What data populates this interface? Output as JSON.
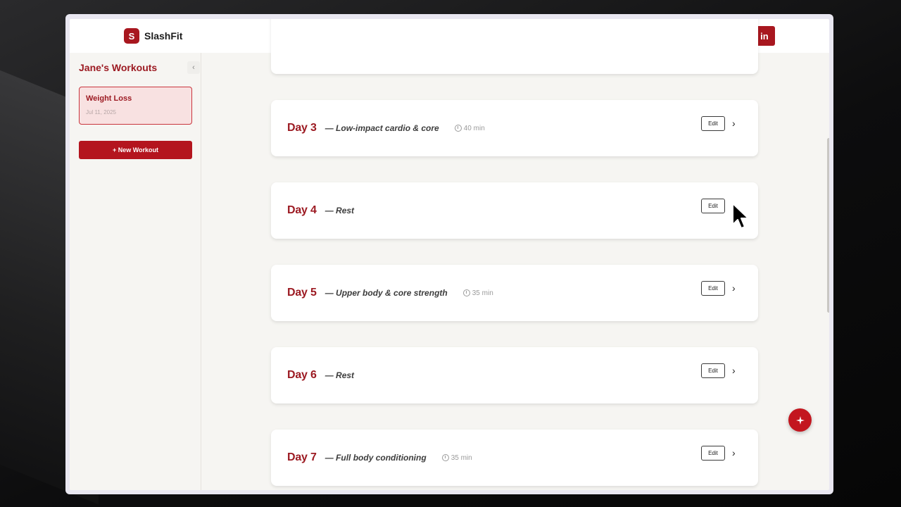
{
  "app": {
    "logo_letter": "S",
    "name": "SlashFit",
    "sign_in_label": "Sign in"
  },
  "sidebar": {
    "title": "Jane's Workouts",
    "collapse_glyph": "‹",
    "workouts": [
      {
        "name": "Weight Loss",
        "date": "Jul 11, 2025"
      }
    ],
    "new_workout_label": "+ New Workout"
  },
  "days": [
    {
      "day": "Day 3",
      "desc": "— Low-impact cardio & core",
      "duration": "40 min",
      "edit_label": "Edit"
    },
    {
      "day": "Day 4",
      "desc": "— Rest",
      "duration": "",
      "edit_label": "Edit"
    },
    {
      "day": "Day 5",
      "desc": "— Upper body & core strength",
      "duration": "35 min",
      "edit_label": "Edit"
    },
    {
      "day": "Day 6",
      "desc": "— Rest",
      "duration": "",
      "edit_label": "Edit"
    },
    {
      "day": "Day 7",
      "desc": "— Full body conditioning",
      "duration": "35 min",
      "edit_label": "Edit"
    }
  ],
  "icons": {
    "chevron": "›",
    "fab": "ai-sparkle-icon",
    "timer": "timer-icon"
  },
  "colors": {
    "brand": "#a8171f",
    "selected_bg": "#f8e1e1",
    "page_bg": "#f6f5f2"
  }
}
